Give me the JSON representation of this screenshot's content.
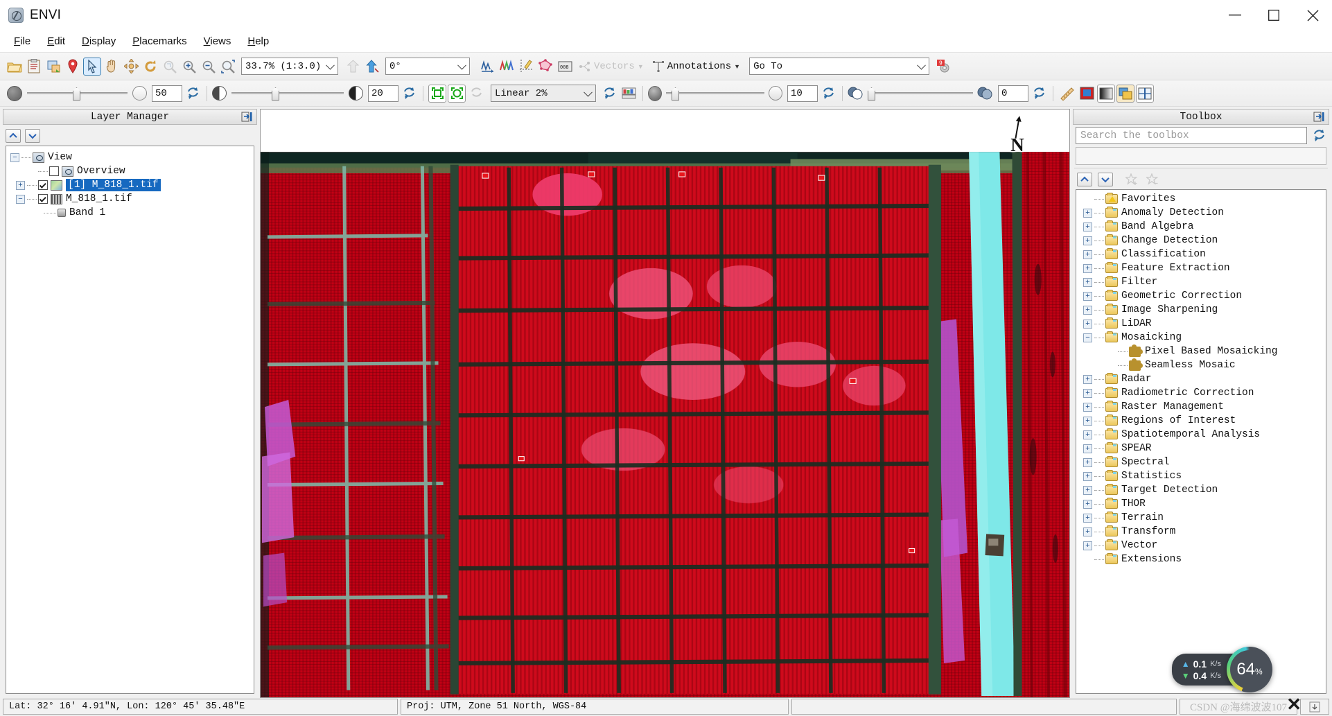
{
  "window": {
    "app_title": "ENVI",
    "app_icon": "envi-logo-icon",
    "minimize_label": "minimize-icon",
    "maximize_label": "maximize-icon",
    "close_label": "close-icon"
  },
  "menu": {
    "items": [
      {
        "label": "File",
        "accel": "F"
      },
      {
        "label": "Edit",
        "accel": "E"
      },
      {
        "label": "Display",
        "accel": "D"
      },
      {
        "label": "Placemarks",
        "accel": "P"
      },
      {
        "label": "Views",
        "accel": "V"
      },
      {
        "label": "Help",
        "accel": "H"
      }
    ]
  },
  "toolbar_main": {
    "buttons": [
      {
        "name": "open-file-icon",
        "glyph": "folder"
      },
      {
        "name": "paste-clipboard-icon",
        "glyph": "clipboard"
      },
      {
        "name": "crop-subset-icon",
        "glyph": "crop"
      },
      {
        "name": "placemark-pin-icon",
        "glyph": "pin"
      },
      {
        "name": "select-pointer-icon",
        "glyph": "pointer",
        "selected": true
      },
      {
        "name": "pan-hand-icon",
        "glyph": "hand"
      },
      {
        "name": "fly-navigate-icon",
        "glyph": "fly"
      },
      {
        "name": "rotate-icon",
        "glyph": "rotate"
      },
      {
        "name": "zoom-to-fit-icon",
        "glyph": "zoomfit",
        "disabled": true
      },
      {
        "name": "zoom-in-icon",
        "glyph": "zoomin"
      },
      {
        "name": "zoom-out-icon",
        "glyph": "zoomout"
      },
      {
        "name": "zoom-to-selection-icon",
        "glyph": "zoomsel"
      }
    ],
    "zoom_value": "33.7% (1:3.0)",
    "rotation_value": "0°",
    "north-up_icon": "north-up-icon",
    "rotate-north_icon": "rotate-north-icon",
    "extra_buttons": [
      {
        "name": "spectral-profile-icon"
      },
      {
        "name": "multi-spectral-profile-icon"
      },
      {
        "name": "pixel-locator-icon"
      },
      {
        "name": "region-of-interest-icon"
      },
      {
        "name": "data-values-icon"
      }
    ],
    "vectors_label": "Vectors",
    "annotations_label": "Annotations",
    "goto_value": "Go To",
    "preferences_icon": "preferences-gear-icon",
    "preferences_badge": "9"
  },
  "toolbar_display": {
    "brightness_icon": "brightness-icon",
    "brightness_value": "50",
    "brightness_reset": "reset-brightness-icon",
    "contrast_icon": "contrast-icon",
    "contrast_value": "20",
    "contrast_reset": "reset-contrast-icon",
    "stretch_full_icon": "stretch-full-extent-icon",
    "stretch_view_icon": "stretch-view-extent-icon",
    "stretch_refresh_icon": "stretch-refresh-icon",
    "stretch_value": "Linear 2%",
    "stretch_reset": "reset-stretch-icon",
    "histogram_icon": "histogram-stretch-icon",
    "sharpen_icon": "sharpen-icon",
    "sharpen_value": "10",
    "sharpen_reset": "reset-sharpen-icon",
    "transparency_icon": "transparency-icon",
    "transparency_value": "0",
    "transparency_reset": "reset-transparency-icon",
    "right_buttons": [
      {
        "name": "measurement-tool-icon"
      },
      {
        "name": "portal-icon"
      },
      {
        "name": "blend-view-icon"
      },
      {
        "name": "flicker-view-icon"
      },
      {
        "name": "swipe-view-icon"
      }
    ]
  },
  "layer_manager": {
    "title": "Layer Manager",
    "pin_icon": "pin-panel-icon",
    "move_up_icon": "move-layer-up-icon",
    "move_down_icon": "move-layer-down-icon",
    "tree": [
      {
        "label": "View",
        "indent": 0,
        "expander": "minus",
        "icon": "view-icon",
        "checkbox": "none",
        "selected": false
      },
      {
        "label": "Overview",
        "indent": 1,
        "expander": "none",
        "icon": "view-icon",
        "checkbox": "unchecked",
        "selected": false
      },
      {
        "label": "[1] M_818_1.tif",
        "indent": 1,
        "expander": "plus",
        "icon": "raster-icon",
        "checkbox": "checked",
        "selected": true
      },
      {
        "label": "M_818_1.tif",
        "indent": 1,
        "expander": "minus",
        "icon": "raster-gray-icon",
        "checkbox": "checked",
        "selected": false
      },
      {
        "label": "Band 1",
        "indent": 2,
        "expander": "none",
        "icon": "band-icon",
        "checkbox": "none",
        "selected": false
      }
    ]
  },
  "toolbox": {
    "title": "Toolbox",
    "pin_icon": "pin-panel-icon",
    "search_placeholder": "Search the toolbox",
    "search_value": "",
    "refresh_icon": "refresh-toolbox-icon",
    "move_up_icon": "move-up-icon",
    "move_down_icon": "move-down-icon",
    "add_favorite_icon": "add-favorite-star-icon",
    "remove_favorite_icon": "remove-favorite-star-icon",
    "tree": [
      {
        "label": "Favorites",
        "indent": 0,
        "expander": "none",
        "icon": "favorites-folder-icon"
      },
      {
        "label": "Anomaly Detection",
        "indent": 0,
        "expander": "plus",
        "icon": "folder-icon"
      },
      {
        "label": "Band Algebra",
        "indent": 0,
        "expander": "plus",
        "icon": "folder-icon"
      },
      {
        "label": "Change Detection",
        "indent": 0,
        "expander": "plus",
        "icon": "folder-icon"
      },
      {
        "label": "Classification",
        "indent": 0,
        "expander": "plus",
        "icon": "folder-icon"
      },
      {
        "label": "Feature Extraction",
        "indent": 0,
        "expander": "plus",
        "icon": "folder-icon"
      },
      {
        "label": "Filter",
        "indent": 0,
        "expander": "plus",
        "icon": "folder-icon"
      },
      {
        "label": "Geometric Correction",
        "indent": 0,
        "expander": "plus",
        "icon": "folder-icon"
      },
      {
        "label": "Image Sharpening",
        "indent": 0,
        "expander": "plus",
        "icon": "folder-icon"
      },
      {
        "label": "LiDAR",
        "indent": 0,
        "expander": "plus",
        "icon": "folder-icon"
      },
      {
        "label": "Mosaicking",
        "indent": 0,
        "expander": "minus",
        "icon": "folder-open-icon"
      },
      {
        "label": "Pixel Based Mosaicking",
        "indent": 1,
        "expander": "none",
        "icon": "tool-puzzle-icon"
      },
      {
        "label": "Seamless Mosaic",
        "indent": 1,
        "expander": "none",
        "icon": "tool-puzzle-icon"
      },
      {
        "label": "Radar",
        "indent": 0,
        "expander": "plus",
        "icon": "folder-icon"
      },
      {
        "label": "Radiometric Correction",
        "indent": 0,
        "expander": "plus",
        "icon": "folder-icon"
      },
      {
        "label": "Raster Management",
        "indent": 0,
        "expander": "plus",
        "icon": "folder-icon"
      },
      {
        "label": "Regions of Interest",
        "indent": 0,
        "expander": "plus",
        "icon": "folder-icon"
      },
      {
        "label": "Spatiotemporal Analysis",
        "indent": 0,
        "expander": "plus",
        "icon": "folder-icon"
      },
      {
        "label": "SPEAR",
        "indent": 0,
        "expander": "plus",
        "icon": "folder-icon"
      },
      {
        "label": "Spectral",
        "indent": 0,
        "expander": "plus",
        "icon": "folder-icon"
      },
      {
        "label": "Statistics",
        "indent": 0,
        "expander": "plus",
        "icon": "folder-icon"
      },
      {
        "label": "Target Detection",
        "indent": 0,
        "expander": "plus",
        "icon": "folder-icon"
      },
      {
        "label": "THOR",
        "indent": 0,
        "expander": "plus",
        "icon": "folder-icon"
      },
      {
        "label": "Terrain",
        "indent": 0,
        "expander": "plus",
        "icon": "folder-icon"
      },
      {
        "label": "Transform",
        "indent": 0,
        "expander": "plus",
        "icon": "folder-icon"
      },
      {
        "label": "Vector",
        "indent": 0,
        "expander": "plus",
        "icon": "folder-icon"
      },
      {
        "label": "Extensions",
        "indent": 0,
        "expander": "none",
        "icon": "folder-icon"
      }
    ]
  },
  "view": {
    "north_arrow_label": "N",
    "image_description": "false-color-infrared-aerial-image-of-agricultural-fields"
  },
  "statusbar": {
    "coordinates": "Lat: 32° 16′ 4.91″N, Lon: 120° 45′ 35.48″E",
    "projection": "Proj: UTM, Zone 51 North, WGS-84",
    "extra": ""
  },
  "net_widget": {
    "upload_value": "0.1",
    "upload_unit": "K/s",
    "download_value": "0.4",
    "download_unit": "K/s",
    "percent": "64",
    "percent_unit": "%"
  },
  "watermark": {
    "text": "CSDN @海绵波波107"
  },
  "colors": {
    "accent_blue": "#1669c0",
    "panel_bg": "#f0f0f0",
    "selected_blue": "#d9ecff",
    "water_cyan": "#6fe3e3",
    "crop_red": "#c80016"
  }
}
